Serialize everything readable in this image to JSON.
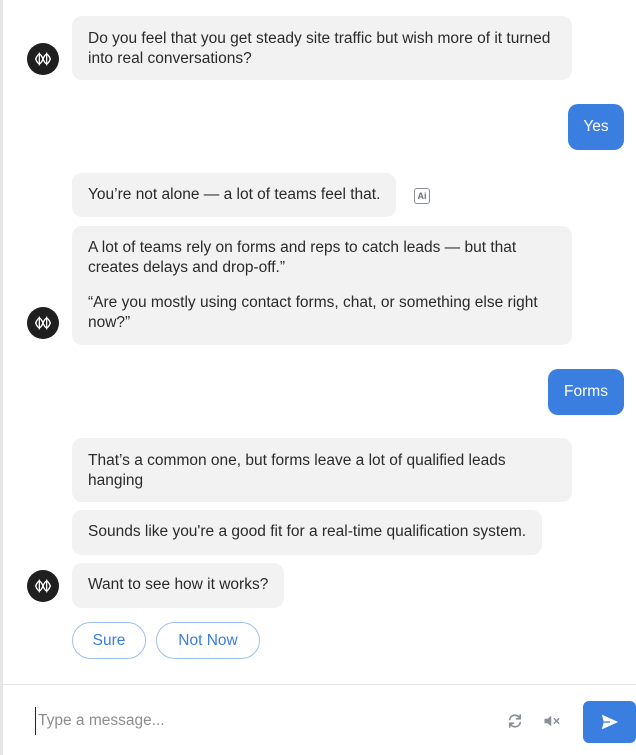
{
  "messages": {
    "m1": "Do you feel that you get steady site traffic but wish more of it turned into real conversations?",
    "u1": "Yes",
    "m2": "You’re not alone — a lot of teams feel that.",
    "m3a": "A lot of teams rely on forms and reps to catch leads — but that creates delays and drop-off.”",
    "m3b": "“Are you mostly using contact forms, chat, or something else right now?”",
    "u2": "Forms",
    "m4": "That’s a common one, but forms leave a lot of qualified leads hanging",
    "m5": "Sounds like you're a good fit for a real-time qualification system.",
    "m6": "Want to see how it works?"
  },
  "ai_badge": "Ai",
  "quick_replies": [
    "Sure",
    "Not Now"
  ],
  "composer": {
    "placeholder": "Type a message..."
  },
  "colors": {
    "accent": "#3a7ee0",
    "bot_bubble": "#f2f2f2",
    "avatar": "#1f1f1f"
  },
  "icons": {
    "avatar": "bot-logo-icon",
    "badge": "ai-label-icon",
    "refresh": "refresh-icon",
    "mute": "speaker-muted-icon",
    "send": "send-icon"
  }
}
